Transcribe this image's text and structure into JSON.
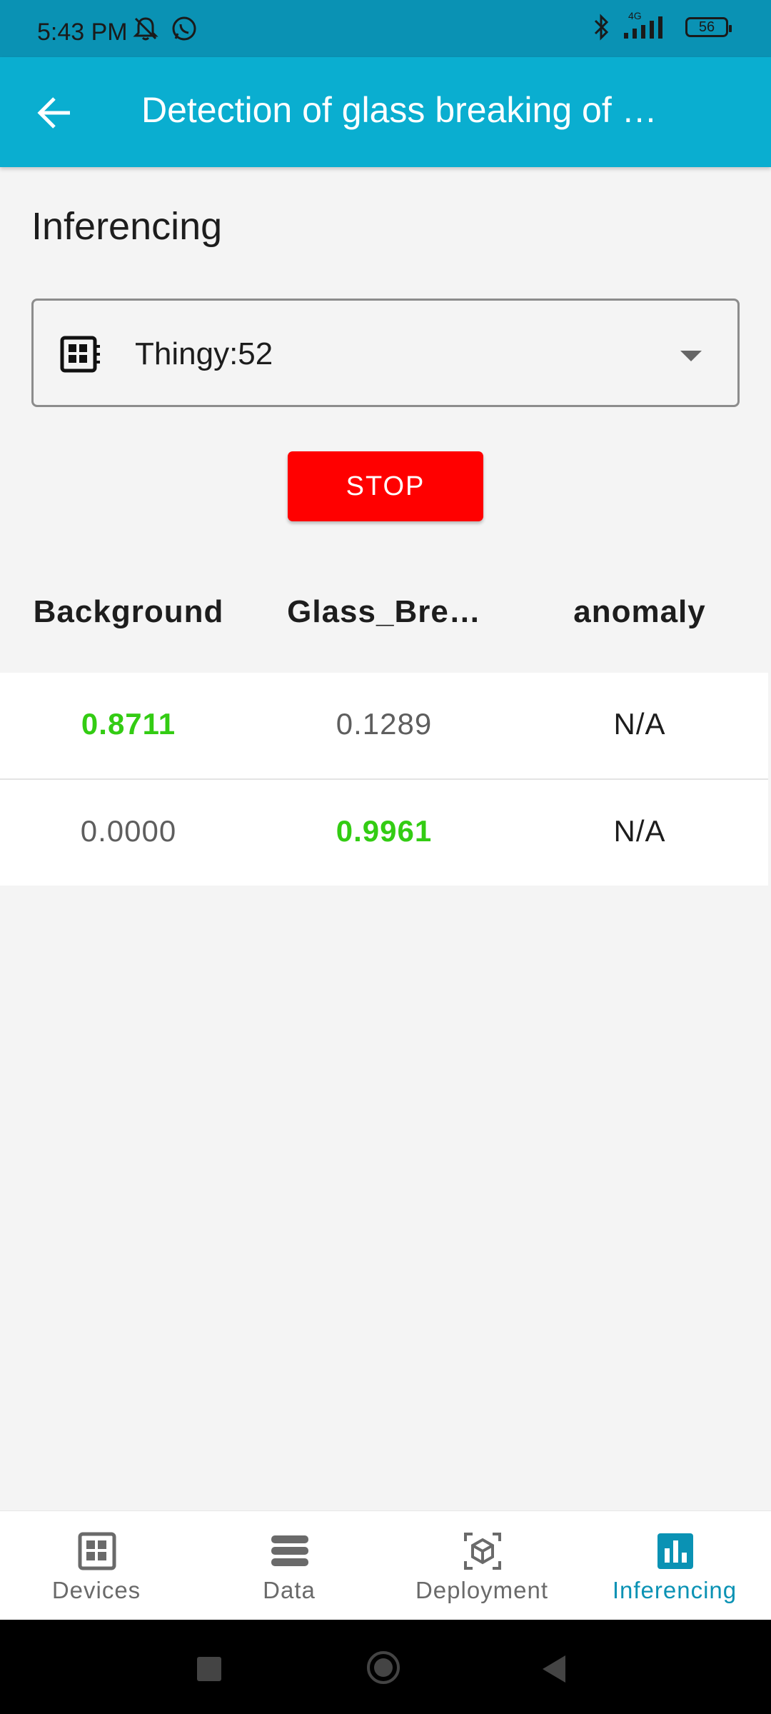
{
  "status_bar": {
    "time": "5:43 PM",
    "network_label": "4G",
    "battery_level": "56",
    "icons": [
      "mute-bell-icon",
      "whatsapp-icon",
      "bluetooth-icon",
      "signal-icon",
      "battery-icon"
    ]
  },
  "app_bar": {
    "title": "Detection of glass breaking of …",
    "back_icon": "arrow-left-icon"
  },
  "page": {
    "section_title": "Inferencing"
  },
  "device_selector": {
    "icon": "chip-icon",
    "selected": "Thingy:52"
  },
  "stop_button": {
    "label": "STOP",
    "color": "#ff0000"
  },
  "results_table": {
    "headers": [
      "Background",
      "Glass_Bre…",
      "anomaly"
    ],
    "rows": [
      [
        "0.8711",
        "0.1289",
        "N/A"
      ],
      [
        "0.0000",
        "0.9961",
        "N/A"
      ]
    ],
    "highlight_color": "#33cc13"
  },
  "bottom_nav": {
    "active_color": "#0a92b4",
    "items": [
      {
        "label": "Devices",
        "icon": "devices-icon"
      },
      {
        "label": "Data",
        "icon": "data-icon"
      },
      {
        "label": "Deployment",
        "icon": "deployment-icon"
      },
      {
        "label": "Inferencing",
        "icon": "inferencing-icon"
      }
    ]
  },
  "colors": {
    "status_bar": "#0a92b4",
    "app_bar": "#0aaed0",
    "background": "#f4f4f4"
  }
}
